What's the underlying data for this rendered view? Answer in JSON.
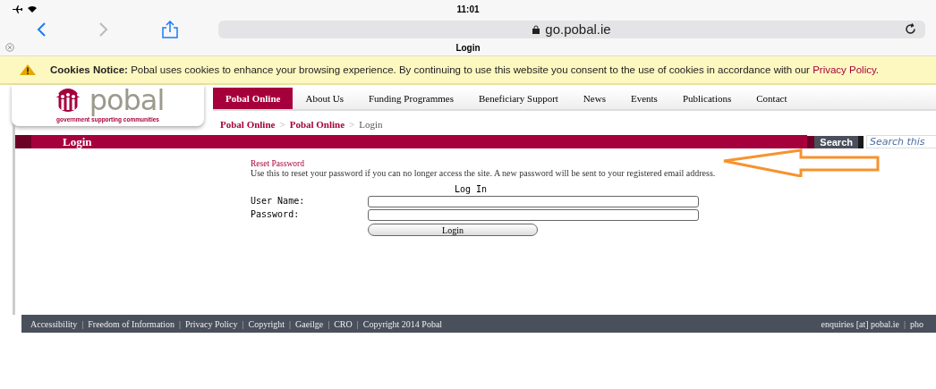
{
  "status_bar": {
    "time": "11:01"
  },
  "browser": {
    "url": "go.pobal.ie",
    "tab_title": "Login"
  },
  "cookie_notice": {
    "title": "Cookies Notice:",
    "text": "Pobal uses cookies to enhance your browsing experience. By continuing to use this website you consent to the use of cookies in accordance with our",
    "link": "Privacy Policy",
    "end": "."
  },
  "logo": {
    "name": "pobal",
    "tagline": "government supporting communities"
  },
  "nav": [
    {
      "label": "Pobal Online",
      "selected": true
    },
    {
      "label": "About Us",
      "selected": false
    },
    {
      "label": "Funding Programmes",
      "selected": false
    },
    {
      "label": "Beneficiary Support",
      "selected": false
    },
    {
      "label": "News",
      "selected": false
    },
    {
      "label": "Events",
      "selected": false
    },
    {
      "label": "Publications",
      "selected": false
    },
    {
      "label": "Contact",
      "selected": false
    }
  ],
  "breadcrumb": [
    {
      "kind": "link",
      "text": "Pobal Online"
    },
    {
      "kind": "sep",
      "text": ">"
    },
    {
      "kind": "link",
      "text": "Pobal Online"
    },
    {
      "kind": "sep",
      "text": ">"
    },
    {
      "kind": "current",
      "text": "Login"
    }
  ],
  "page_title": "Login",
  "search": {
    "button": "Search",
    "placeholder": "Search this"
  },
  "reset": {
    "link": "Reset Password",
    "text": "Use this to reset your password if you can no longer access the site. A new password will be sent to your registered email address."
  },
  "form": {
    "heading": "Log In",
    "fields": [
      {
        "label": "User Name:"
      },
      {
        "label": "Password:"
      }
    ],
    "button": "Login"
  },
  "footer": {
    "left": [
      {
        "kind": "link",
        "text": "Accessibility"
      },
      {
        "kind": "sep",
        "text": "|"
      },
      {
        "kind": "link",
        "text": "Freedom of Information"
      },
      {
        "kind": "sep",
        "text": "|"
      },
      {
        "kind": "link",
        "text": "Privacy Policy"
      },
      {
        "kind": "sep",
        "text": "|"
      },
      {
        "kind": "link",
        "text": "Copyright"
      },
      {
        "kind": "sep",
        "text": "|"
      },
      {
        "kind": "link",
        "text": "Gaeilge"
      },
      {
        "kind": "sep",
        "text": "|"
      },
      {
        "kind": "link",
        "text": "CRO"
      },
      {
        "kind": "sep",
        "text": "|"
      },
      {
        "kind": "link",
        "text": "Copyright 2014 Pobal"
      }
    ],
    "right": [
      {
        "kind": "link",
        "text": "enquiries [at] pobal.ie"
      },
      {
        "kind": "sep",
        "text": "|"
      },
      {
        "kind": "link",
        "text": "pho"
      }
    ]
  }
}
